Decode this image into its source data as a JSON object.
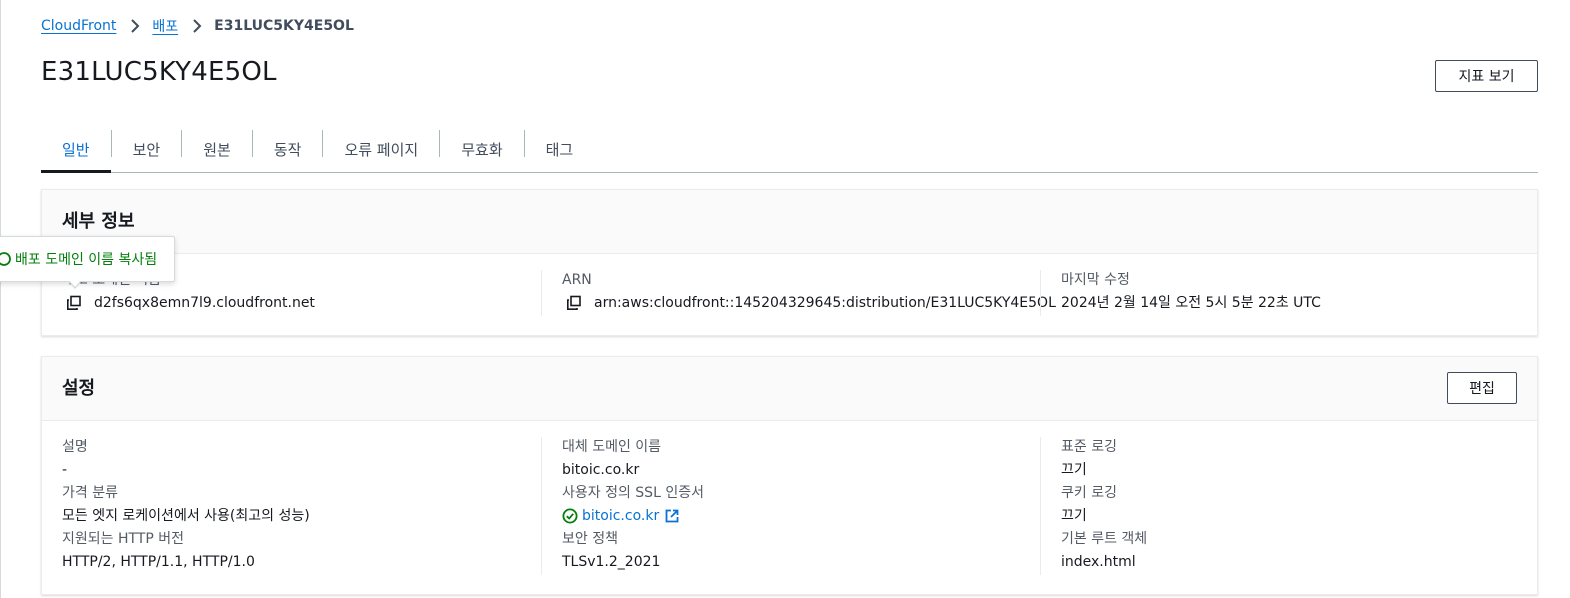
{
  "breadcrumb": {
    "items": [
      "CloudFront",
      "배포"
    ],
    "current": "E31LUC5KY4E5OL"
  },
  "page": {
    "title": "E31LUC5KY4E5OL",
    "metrics_button": "지표 보기"
  },
  "tabs": [
    {
      "label": "일반",
      "active": true
    },
    {
      "label": "보안"
    },
    {
      "label": "원본"
    },
    {
      "label": "동작"
    },
    {
      "label": "오류 페이지"
    },
    {
      "label": "무효화"
    },
    {
      "label": "태그"
    }
  ],
  "details": {
    "title": "세부 정보",
    "domain_label": "배포 도메인 이름",
    "domain_value": "d2fs6qx8emn7l9.cloudfront.net",
    "arn_label": "ARN",
    "arn_value": "arn:aws:cloudfront::145204329645:distribution/E31LUC5KY4E5OL",
    "modified_label": "마지막 수정",
    "modified_value": "2024년 2월 14일 오전 5시 5분 22초 UTC"
  },
  "toast": {
    "message": "배포 도메인 이름 복사됨"
  },
  "settings": {
    "title": "설정",
    "edit_button": "편집",
    "description_label": "설명",
    "description_value": "-",
    "price_class_label": "가격 분류",
    "price_class_value": "모든 엣지 로케이션에서 사용(최고의 성능)",
    "http_version_label": "지원되는 HTTP 버전",
    "http_version_value": "HTTP/2, HTTP/1.1, HTTP/1.0",
    "alt_domain_label": "대체 도메인 이름",
    "alt_domain_value": "bitoic.co.kr",
    "ssl_label": "사용자 정의 SSL 인증서",
    "ssl_value": "bitoic.co.kr",
    "security_policy_label": "보안 정책",
    "security_policy_value": "TLSv1.2_2021",
    "std_logging_label": "표준 로깅",
    "std_logging_value": "끄기",
    "cookie_logging_label": "쿠키 로깅",
    "cookie_logging_value": "끄기",
    "root_object_label": "기본 루트 객체",
    "root_object_value": "index.html"
  },
  "colors": {
    "link": "#0972d3",
    "success": "#037f0c",
    "text": "#16191f",
    "label": "#545b64"
  }
}
